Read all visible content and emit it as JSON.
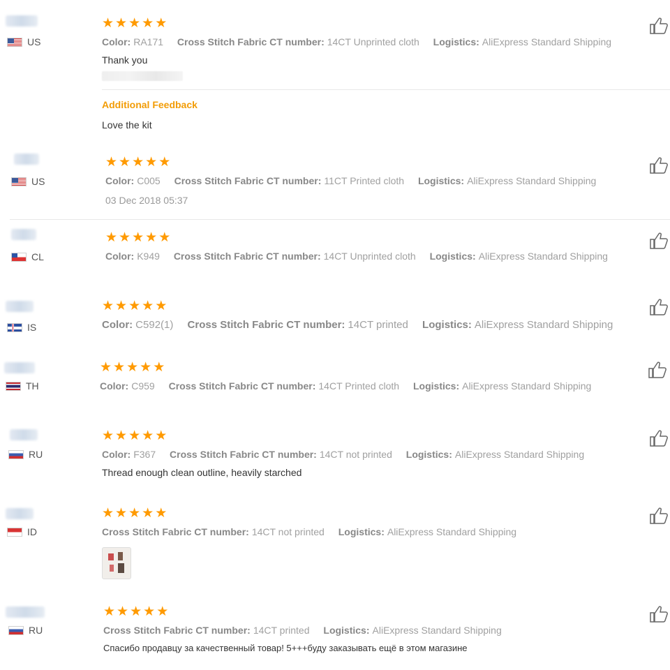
{
  "colors": {
    "star": "#ff9a00",
    "accent": "#f29c06"
  },
  "icons": {
    "rating": "star-icon",
    "like": "thumbs-up-icon",
    "flag": "country-flag-icon"
  },
  "labels": {
    "color": "Color:",
    "ct": "Cross Stitch Fabric CT number:",
    "logistics": "Logistics:"
  },
  "reviews": [
    {
      "country": "US",
      "rating": 5,
      "color": "RA171",
      "ct": "14CT Unprinted cloth",
      "logistics": "AliExpress Standard Shipping",
      "text": "Thank you",
      "additional": {
        "title": "Additional Feedback",
        "text": "Love the kit"
      }
    },
    {
      "country": "US",
      "rating": 5,
      "color": "C005",
      "ct": "11CT Printed cloth",
      "logistics": "AliExpress Standard Shipping",
      "date": "03 Dec 2018 05:37"
    },
    {
      "country": "CL",
      "rating": 5,
      "color": "K949",
      "ct": "14CT Unprinted cloth",
      "logistics": "AliExpress Standard Shipping"
    },
    {
      "country": "IS",
      "rating": 5,
      "color": "C592(1)",
      "ct": "14CT printed",
      "logistics": "AliExpress Standard Shipping"
    },
    {
      "country": "TH",
      "rating": 5,
      "color": "C959",
      "ct": "14CT Printed cloth",
      "logistics": "AliExpress Standard Shipping"
    },
    {
      "country": "RU",
      "rating": 5,
      "color": "F367",
      "ct": "14CT not printed",
      "logistics": "AliExpress Standard Shipping",
      "text": "Thread enough clean outline, heavily starched"
    },
    {
      "country": "ID",
      "rating": 5,
      "ct": "14CT not printed",
      "logistics": "AliExpress Standard Shipping"
    },
    {
      "country": "RU",
      "rating": 5,
      "ct": "14CT printed",
      "logistics": "AliExpress Standard Shipping",
      "text": "Спасибо продавцу за качественный товар! 5+++буду заказывать ещё в этом магазине"
    }
  ]
}
